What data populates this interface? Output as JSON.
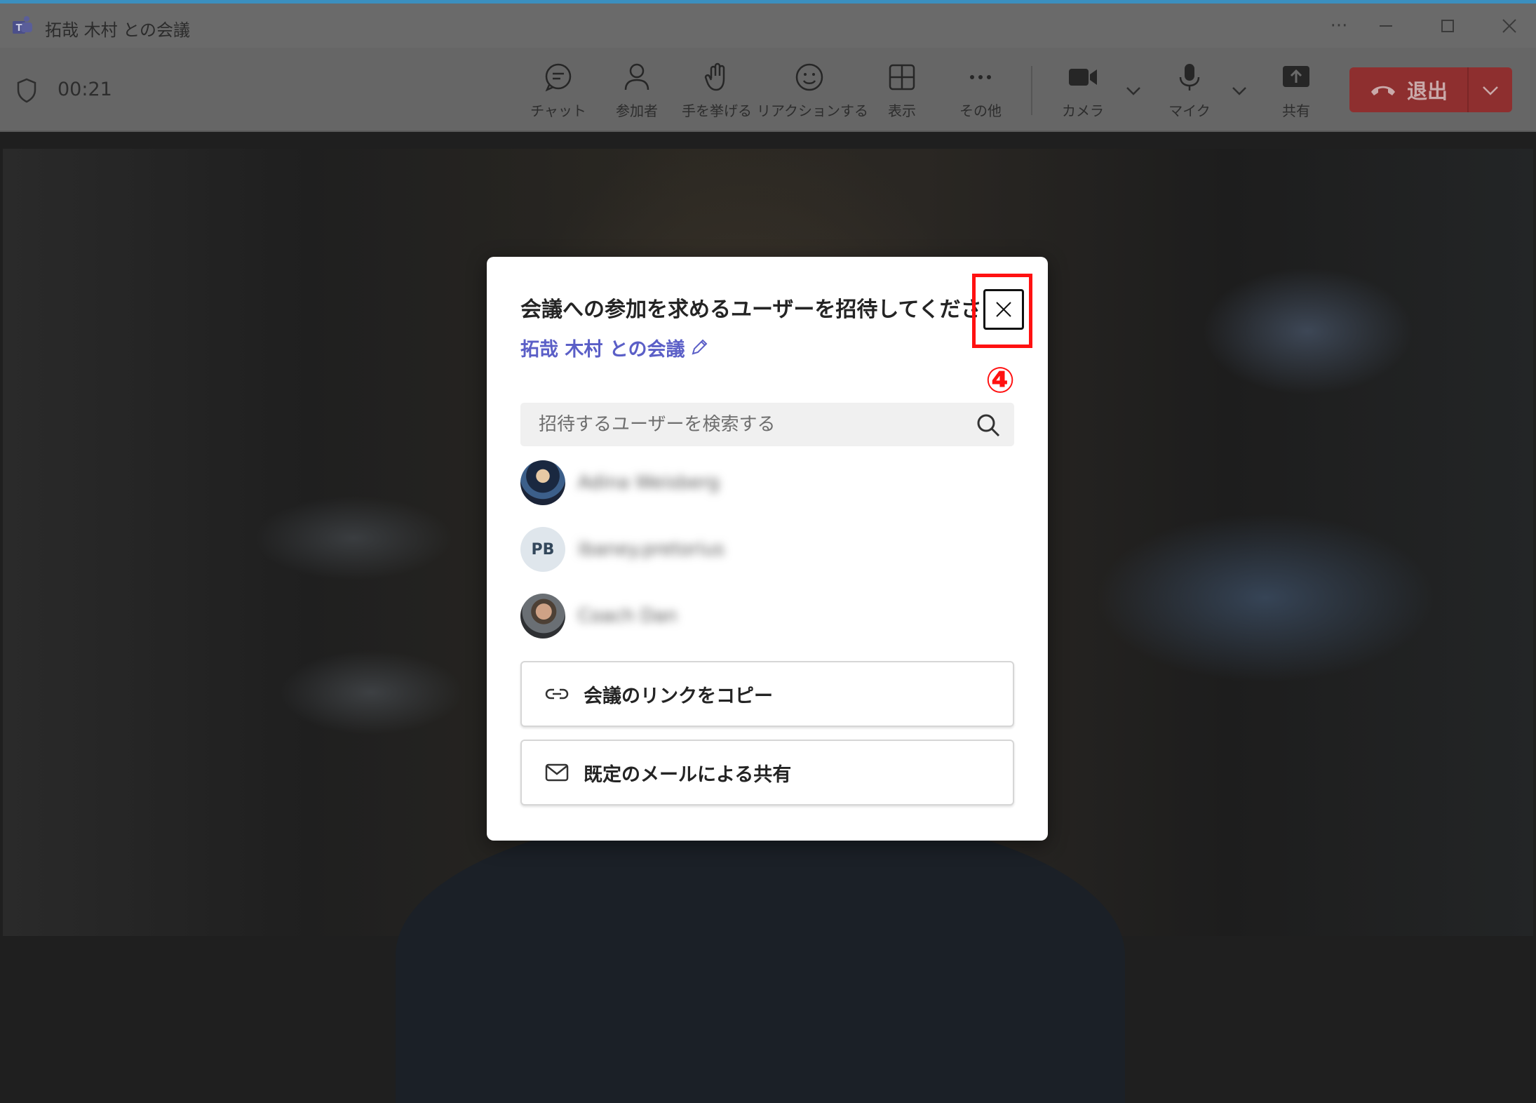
{
  "window": {
    "title": "拓哉 木村 との会議",
    "controls": [
      "more",
      "minimize",
      "maximize",
      "close"
    ]
  },
  "toolbar": {
    "timer": "00:21",
    "buttons": [
      {
        "id": "chat",
        "label": "チャット",
        "icon": "chat-icon"
      },
      {
        "id": "participants",
        "label": "参加者",
        "icon": "people-icon"
      },
      {
        "id": "raise-hand",
        "label": "手を挙げる",
        "icon": "hand-icon"
      },
      {
        "id": "reactions",
        "label": "リアクションする",
        "icon": "smiley-icon"
      },
      {
        "id": "view",
        "label": "表示",
        "icon": "grid-icon"
      },
      {
        "id": "more",
        "label": "その他",
        "icon": "ellipsis-icon"
      },
      {
        "id": "camera",
        "label": "カメラ",
        "icon": "camera-icon"
      },
      {
        "id": "mic",
        "label": "マイク",
        "icon": "mic-icon"
      },
      {
        "id": "share",
        "label": "共有",
        "icon": "share-icon"
      }
    ],
    "leave_label": "退出",
    "leave_color": "#8e2f2f"
  },
  "dialog": {
    "title": "会議への参加を求めるユーザーを招待してください",
    "meeting_name": "拓哉 木村 との会議",
    "annotation": "④",
    "search_placeholder": "招待するユーザーを検索する",
    "people": [
      {
        "avatar": "photo",
        "name": "Adina Weisberg"
      },
      {
        "avatar": "initials",
        "initials": "PB",
        "name": "ibaney.pretorius"
      },
      {
        "avatar": "photo",
        "name": "Coach Dan"
      }
    ],
    "actions": [
      {
        "label": "会議のリンクをコピー",
        "icon": "link-icon"
      },
      {
        "label": "既定のメールによる共有",
        "icon": "mail-icon"
      }
    ],
    "accent_color": "#5b5fc7",
    "highlight_color": "#ff1111"
  }
}
